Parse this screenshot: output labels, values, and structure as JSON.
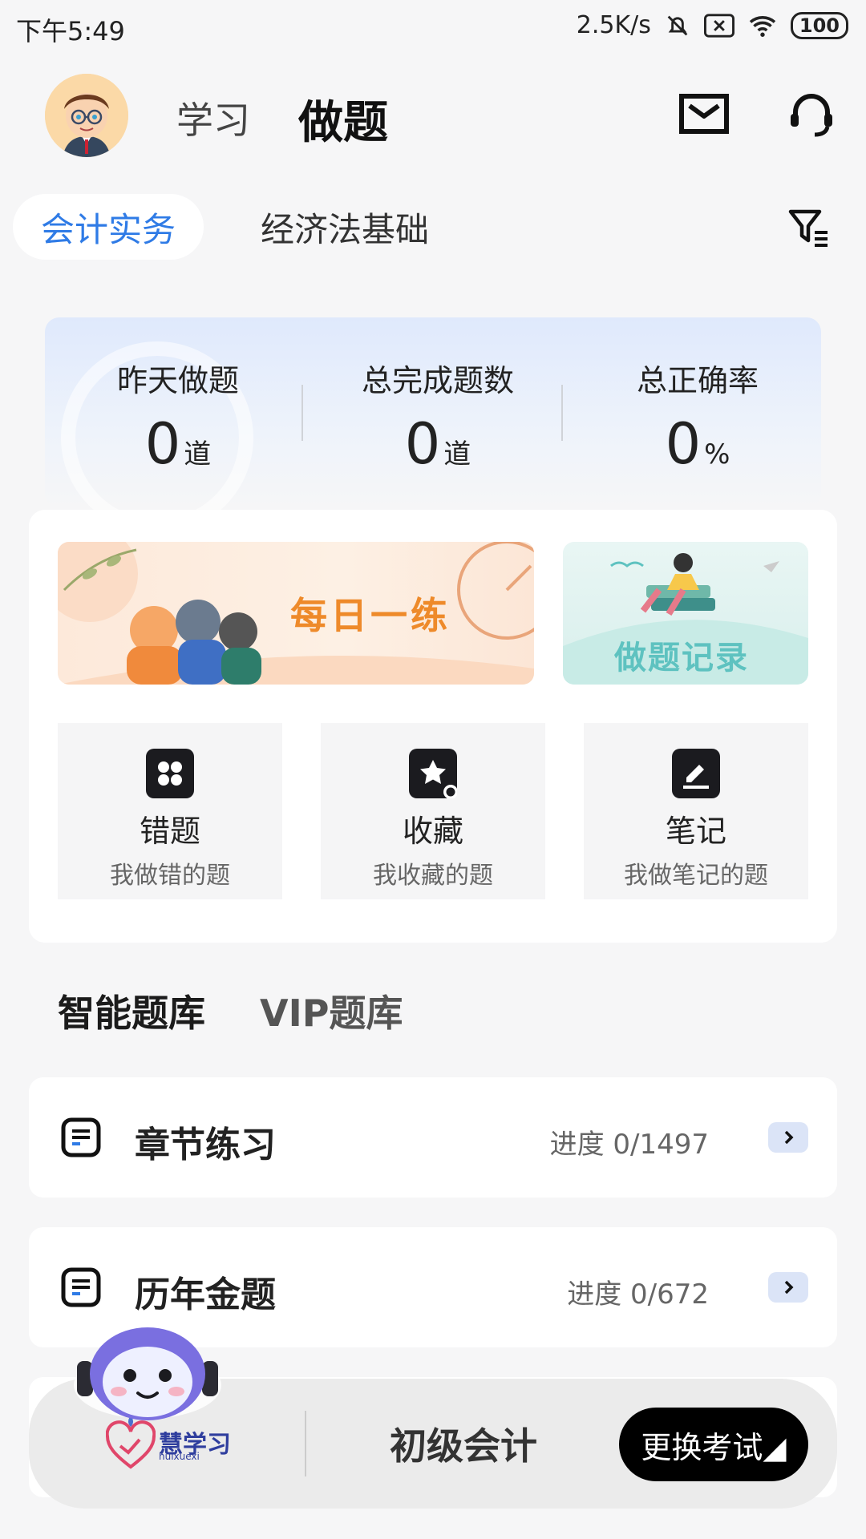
{
  "status": {
    "time": "下午5:49",
    "speed": "2.5K/s",
    "battery": "100"
  },
  "header": {
    "learn_tab": "学习",
    "do_tab": "做题"
  },
  "subjects": {
    "active": "会计实务",
    "other": "经济法基础"
  },
  "stats": {
    "yesterday": {
      "label": "昨天做题",
      "value": "0",
      "unit": "道"
    },
    "total_done": {
      "label": "总完成题数",
      "value": "0",
      "unit": "道"
    },
    "accuracy": {
      "label": "总正确率",
      "value": "0",
      "unit": "%"
    }
  },
  "banners": {
    "daily": "每日一练",
    "record": "做题记录"
  },
  "tiles": [
    {
      "title": "错题",
      "subtitle": "我做错的题"
    },
    {
      "title": "收藏",
      "subtitle": "我收藏的题"
    },
    {
      "title": "笔记",
      "subtitle": "我做笔记的题"
    }
  ],
  "bank_tabs": {
    "active": "智能题库",
    "other": "VIP题库"
  },
  "rows": [
    {
      "title": "章节练习",
      "progress": "进度 0/1497"
    },
    {
      "title": "历年金题",
      "progress": "进度 0/672"
    }
  ],
  "bottom": {
    "brand": "慧学习",
    "brand_sub": "huixuexi",
    "exam": "初级会计",
    "switch": "更换考试◢"
  },
  "colors": {
    "accent": "#2f7be6",
    "orange": "#ee8a2a",
    "teal": "#5ec2c0"
  }
}
